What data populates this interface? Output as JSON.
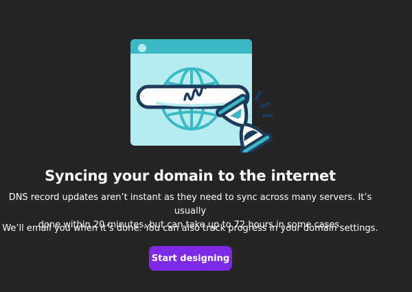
{
  "dialog": {
    "illustration_icon": "syncing-globe-hourglass-illustration",
    "heading": "Syncing your domain to the internet",
    "paragraph_1_line_1": "DNS record updates aren’t instant as they need to sync across many servers. It’s usually",
    "paragraph_1_line_2": "done within 20 minutes, but can take up to 72 hours in some cases.",
    "paragraph_2": "We’ll email you when it’s done. You can also track progress in your domain settings.",
    "primary_button_label": "Start designing"
  },
  "colors": {
    "background": "#252527",
    "text": "#ffffff",
    "button": "#7d2ae8",
    "illustration_teal": "#3ab8c4",
    "illustration_light": "#b6ecef",
    "illustration_navy": "#1b3a5c"
  }
}
